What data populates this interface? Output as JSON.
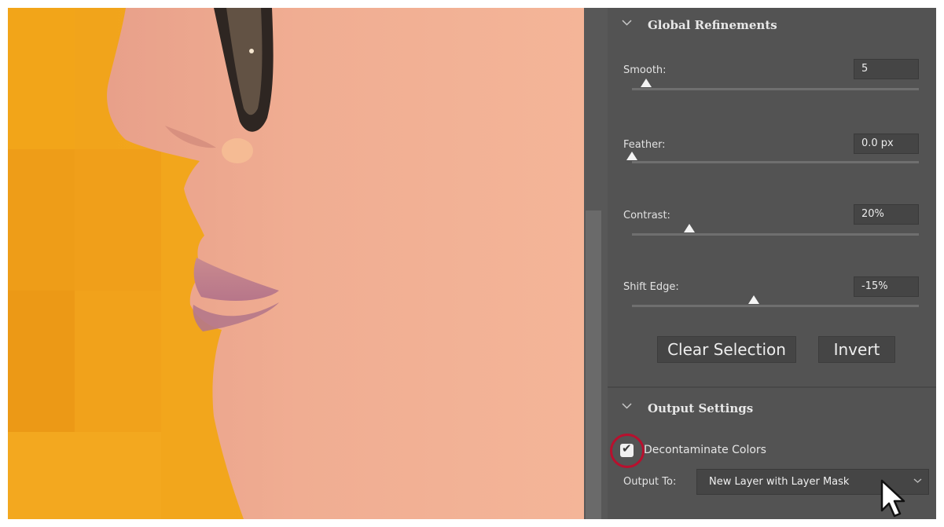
{
  "global_refinements": {
    "title": "Global Refinements",
    "sliders": [
      {
        "label": "Smooth:",
        "value": "5",
        "level": 0.05
      },
      {
        "label": "Feather:",
        "value": "0.0 px",
        "level": 0.0
      },
      {
        "label": "Contrast:",
        "value": "20%",
        "level": 0.2
      },
      {
        "label": "Shift Edge:",
        "value": "-15%",
        "level": 0.425
      }
    ],
    "clear_selection_label": "Clear Selection",
    "invert_label": "Invert"
  },
  "output_settings": {
    "title": "Output Settings",
    "decontaminate_label": "Decontaminate Colors",
    "decontaminate_checked": true,
    "output_to_label": "Output To:",
    "output_to_value": "New Layer with Layer Mask"
  },
  "colors": {
    "panel_bg": "#535353",
    "background_orange": "#f2a61c",
    "highlight_ring": "#b8102e",
    "skin": "#f2b090"
  },
  "icons": [
    "chevron-down-icon",
    "checkmark-icon",
    "select-caret-icon",
    "mouse-pointer-icon"
  ]
}
